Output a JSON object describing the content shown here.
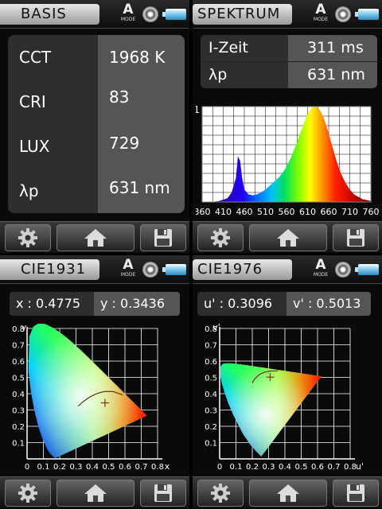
{
  "basis": {
    "title": "BASIS",
    "mode_letter": "A",
    "mode_label": "MODE",
    "rows": [
      {
        "label": "CCT",
        "value": "1968 K"
      },
      {
        "label": "CRI",
        "value": "83"
      },
      {
        "label": "LUX",
        "value": "729"
      },
      {
        "label": "λp",
        "value": "631 nm"
      }
    ]
  },
  "spektrum": {
    "title": "SPEKTRUM",
    "mode_letter": "A",
    "mode_label": "MODE",
    "rows": [
      {
        "label": "I-Zeit",
        "value": "311 ms"
      },
      {
        "label": "λp",
        "value": "631 nm"
      }
    ],
    "chart_data": {
      "type": "area",
      "x_ticks": [
        "360",
        "410",
        "460",
        "510",
        "560",
        "610",
        "660",
        "710",
        "760"
      ],
      "y_tick": "1",
      "xlim": [
        360,
        760
      ],
      "ylim": [
        0,
        1
      ],
      "grid": true,
      "x": [
        380,
        400,
        420,
        430,
        440,
        445,
        450,
        455,
        460,
        470,
        480,
        490,
        500,
        510,
        520,
        530,
        540,
        550,
        560,
        570,
        580,
        590,
        600,
        610,
        620,
        630,
        640,
        650,
        660,
        670,
        680,
        690,
        700,
        710,
        720,
        740,
        760
      ],
      "y": [
        0,
        0.01,
        0.04,
        0.1,
        0.25,
        0.48,
        0.43,
        0.25,
        0.13,
        0.08,
        0.07,
        0.08,
        0.1,
        0.13,
        0.17,
        0.21,
        0.25,
        0.3,
        0.37,
        0.46,
        0.57,
        0.69,
        0.81,
        0.92,
        0.99,
        1.0,
        0.96,
        0.86,
        0.72,
        0.56,
        0.41,
        0.29,
        0.2,
        0.13,
        0.08,
        0.03,
        0.01
      ]
    }
  },
  "cie1931": {
    "title": "CIE1931",
    "mode_letter": "A",
    "mode_label": "MODE",
    "x_label": "x : 0.4775",
    "y_label": "y : 0.3436",
    "chart_data": {
      "type": "scatter",
      "xlabel": "x",
      "ylabel": "y",
      "xlim": [
        0,
        0.8
      ],
      "ylim": [
        0,
        0.8
      ],
      "x_ticks": [
        "0",
        "0.1",
        "0.2",
        "0.3",
        "0.4",
        "0.5",
        "0.6",
        "0.7",
        "0.8"
      ],
      "y_ticks": [
        "0.1",
        "0.2",
        "0.3",
        "0.4",
        "0.5",
        "0.6",
        "0.7",
        "0.8"
      ],
      "point": {
        "x": 0.4775,
        "y": 0.3436
      }
    }
  },
  "cie1976": {
    "title": "CIE1976",
    "mode_letter": "A",
    "mode_label": "MODE",
    "u_label": "u' : 0.3096",
    "v_label": "v' : 0.5013",
    "chart_data": {
      "type": "scatter",
      "xlabel": "u'",
      "ylabel": "v'",
      "xlim": [
        0,
        0.8
      ],
      "ylim": [
        0,
        0.8
      ],
      "x_ticks": [
        "0",
        "0.1",
        "0.2",
        "0.3",
        "0.4",
        "0.5",
        "0.6",
        "0.7",
        "0.8"
      ],
      "y_ticks": [
        "0.1",
        "0.2",
        "0.3",
        "0.4",
        "0.5",
        "0.6",
        "0.7",
        "0.8"
      ],
      "point": {
        "x": 0.3096,
        "y": 0.5013
      }
    }
  },
  "icons": {
    "settings": "gear-icon",
    "home": "home-icon",
    "save": "floppy-disk-icon",
    "lens": "lens-icon",
    "battery": "battery-icon"
  }
}
